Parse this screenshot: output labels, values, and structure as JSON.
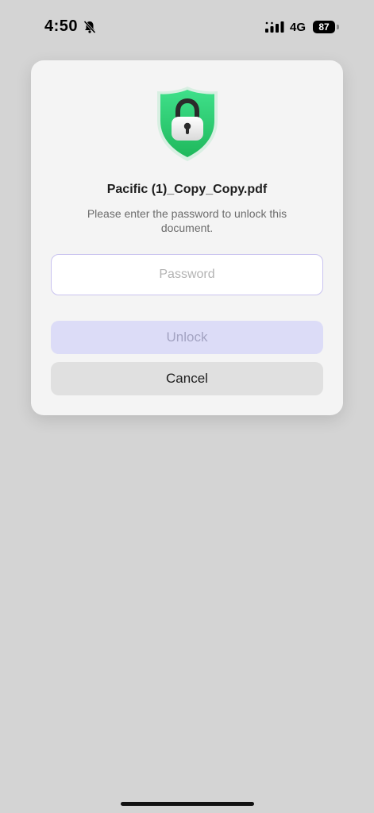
{
  "status_bar": {
    "time": "4:50",
    "network": "4G",
    "battery": "87",
    "icons": [
      "bell-slash-icon",
      "signal-icon",
      "battery-icon"
    ]
  },
  "dialog": {
    "icon": "shield-lock-icon",
    "title": "Pacific (1)_Copy_Copy.pdf",
    "message": "Please enter the password to unlock this document.",
    "password_placeholder": "Password",
    "password_value": "",
    "unlock_label": "Unlock",
    "cancel_label": "Cancel"
  },
  "colors": {
    "background": "#d4d4d4",
    "dialog_background": "#f4f4f4",
    "shield_green": "#2fcf6f",
    "unlock_disabled": "#dcdcf7",
    "cancel_background": "#e0e0e0"
  }
}
